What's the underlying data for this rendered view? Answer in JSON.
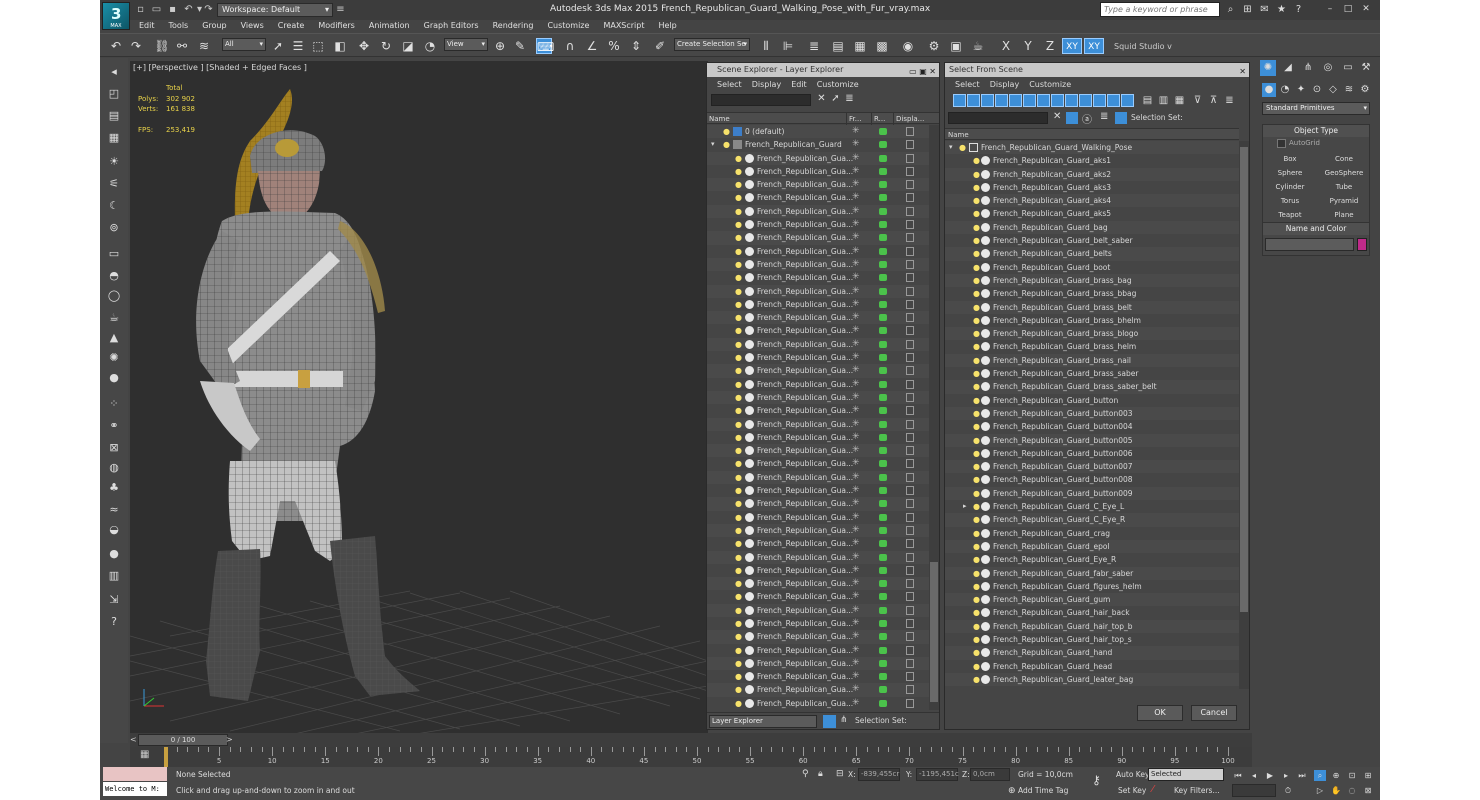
{
  "app": {
    "logo_text": "MAX",
    "workspace": "Workspace: Default",
    "title": "Autodesk 3ds Max  2015     French_Republican_Guard_Walking_Pose_with_Fur_vray.max",
    "search_placeholder": "Type a keyword or phrase"
  },
  "menu": [
    "Edit",
    "Tools",
    "Group",
    "Views",
    "Create",
    "Modifiers",
    "Animation",
    "Graph Editors",
    "Rendering",
    "Customize",
    "MAXScript",
    "Help"
  ],
  "toolbar": {
    "selection_filter": "All",
    "ref_coord": "View",
    "named_selection": "Create Selection Se",
    "axis_x": "X",
    "axis_y": "Y",
    "axis_z": "Z",
    "axis_xy": "XY",
    "axis_xy2": "XY",
    "studio": "Squid Studio v"
  },
  "viewport": {
    "label": "[+] [Perspective ] [Shaded + Edged Faces ]",
    "stats_header": "Total",
    "polys_label": "Polys:",
    "polys_value": "302 902",
    "verts_label": "Verts:",
    "verts_value": "161 838",
    "fps_label": "FPS:",
    "fps_value": "253,419"
  },
  "scene_explorer": {
    "title": "Scene Explorer - Layer Explorer",
    "menu": [
      "Select",
      "Display",
      "Edit",
      "Customize"
    ],
    "columns": [
      "Name",
      "Fr...",
      "R...",
      "Displa..."
    ],
    "layer_default": "0 (default)",
    "layer_main": "French_Republican_Guard",
    "child_label": "French_Republican_Gua...",
    "footer_dropdown": "Layer Explorer",
    "footer_selection": "Selection Set:"
  },
  "select_from_scene": {
    "title": "Select From Scene",
    "menu": [
      "Select",
      "Display",
      "Customize"
    ],
    "selection_set": "Selection Set:",
    "column": "Name",
    "root": "French_Republican_Guard_Walking_Pose",
    "items": [
      "French_Republican_Guard_aks1",
      "French_Republican_Guard_aks2",
      "French_Republican_Guard_aks3",
      "French_Republican_Guard_aks4",
      "French_Republican_Guard_aks5",
      "French_Republican_Guard_bag",
      "French_Republican_Guard_belt_saber",
      "French_Republican_Guard_belts",
      "French_Republican_Guard_boot",
      "French_Republican_Guard_brass_bag",
      "French_Republican_Guard_brass_bbag",
      "French_Republican_Guard_brass_belt",
      "French_Republican_Guard_brass_bhelm",
      "French_Republican_Guard_brass_blogo",
      "French_Republican_Guard_brass_helm",
      "French_Republican_Guard_brass_nail",
      "French_Republican_Guard_brass_saber",
      "French_Republican_Guard_brass_saber_belt",
      "French_Republican_Guard_button",
      "French_Republican_Guard_button003",
      "French_Republican_Guard_button004",
      "French_Republican_Guard_button005",
      "French_Republican_Guard_button006",
      "French_Republican_Guard_button007",
      "French_Republican_Guard_button008",
      "French_Republican_Guard_button009",
      "French_Republican_Guard_C_Eye_L",
      "French_Republican_Guard_C_Eye_R",
      "French_Republican_Guard_crag",
      "French_Republican_Guard_epol",
      "French_Republican_Guard_Eye_R",
      "French_Republican_Guard_fabr_saber",
      "French_Republican_Guard_figures_helm",
      "French_Republican_Guard_gum",
      "French_Republican_Guard_hair_back",
      "French_Republican_Guard_hair_top_b",
      "French_Republican_Guard_hair_top_s",
      "French_Republican_Guard_hand",
      "French_Republican_Guard_head",
      "French_Republican_Guard_leater_bag"
    ],
    "ok": "OK",
    "cancel": "Cancel"
  },
  "command_panel": {
    "primitive_type": "Standard Primitives",
    "object_type_header": "Object Type",
    "autogrid": "AutoGrid",
    "buttons": [
      "Box",
      "Cone",
      "Sphere",
      "GeoSphere",
      "Cylinder",
      "Tube",
      "Torus",
      "Pyramid",
      "Teapot",
      "Plane"
    ],
    "name_color_header": "Name and Color",
    "color": "#c02a8a"
  },
  "timeline": {
    "frame_display": "0 / 100",
    "ticks": [
      "0",
      "5",
      "10",
      "15",
      "20",
      "25",
      "30",
      "35",
      "40",
      "45",
      "50",
      "55",
      "60",
      "65",
      "70",
      "75",
      "80",
      "85",
      "90",
      "95",
      "100"
    ]
  },
  "status": {
    "listener": "Welcome to M:",
    "selected": "None Selected",
    "prompt": "Click and drag up-and-down to zoom in and out",
    "x_label": "X:",
    "x_value": "-839,455cr",
    "y_label": "Y:",
    "y_value": "-1195,451c",
    "z_label": "Z:",
    "z_value": "0,0cm",
    "grid": "Grid = 10,0cm",
    "add_time_tag": "Add Time Tag",
    "auto_key": "Auto Key",
    "set_key": "Set Key",
    "key_mode": "Selected",
    "key_filters": "Key Filters..."
  }
}
